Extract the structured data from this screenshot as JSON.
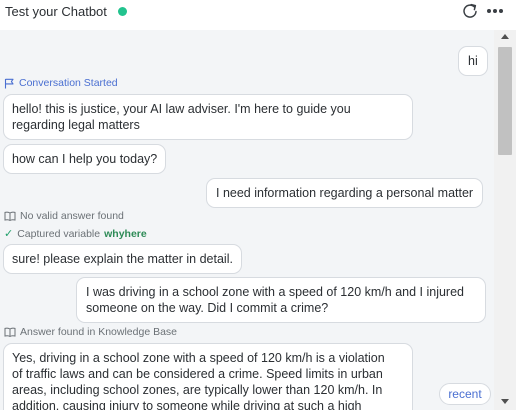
{
  "header": {
    "title": "Test your Chatbot",
    "status_color": "#22c38e"
  },
  "messages": {
    "m1": {
      "role": "user",
      "text": "hi"
    },
    "event1": {
      "icon": "flag-icon",
      "text": "Conversation Started"
    },
    "m2": {
      "role": "bot",
      "line1": "hello! this is justice, your AI law adviser. I'm here to guide you",
      "line2": "regarding legal matters"
    },
    "m3": {
      "role": "bot",
      "text": "how can I help you today?"
    },
    "m4": {
      "role": "user",
      "text": "I need information regarding a personal matter"
    },
    "meta1": {
      "icon": "book-icon",
      "text": "No valid answer found"
    },
    "meta2": {
      "icon": "check-icon",
      "text": "Captured variable",
      "variable": "whyhere"
    },
    "m5": {
      "role": "bot",
      "text": "sure! please explain the matter in detail."
    },
    "m6": {
      "role": "user",
      "line1": "I was driving in a school zone with a speed of 120 km/h and I injured",
      "line2": "someone on the way. Did I commit a crime?"
    },
    "meta3": {
      "icon": "book-icon",
      "text": "Answer found in Knowledge Base"
    },
    "m7": {
      "role": "bot",
      "line1": "Yes, driving in a school zone with a speed of 120 km/h is a violation",
      "line2": "of traffic laws and can be considered a crime. Speed limits in urban",
      "line3": "areas, including school zones, are typically lower than 120 km/h. In",
      "line4": "addition, causing injury to someone while driving at such a high"
    }
  },
  "recent_label": "recent"
}
